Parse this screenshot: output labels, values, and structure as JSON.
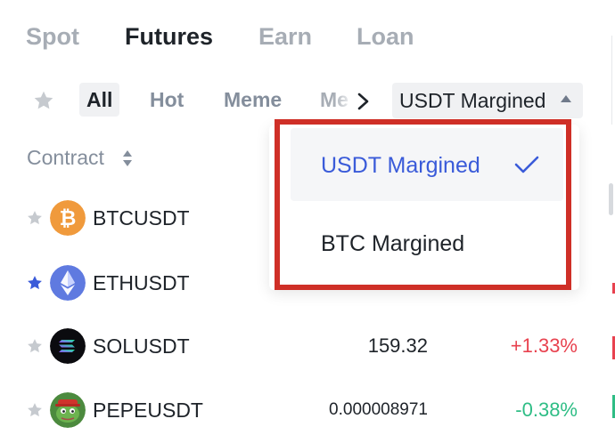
{
  "top_tabs": [
    "Spot",
    "Futures",
    "Earn",
    "Loan"
  ],
  "active_top_tab": "Futures",
  "filters": {
    "chips": [
      "All",
      "Hot",
      "Meme",
      "Me"
    ],
    "active": "All",
    "selector_label": "USDT Margined",
    "favorite_icon": "star-icon",
    "scroll_icon": "chevron-right-icon",
    "selector_icon": "caret-up-icon"
  },
  "table": {
    "header_label": "Contract",
    "sort_icon": "sort-icon",
    "rows": [
      {
        "symbol": "BTCUSDT",
        "favorite": false,
        "price": "",
        "change": "",
        "coin_icon": "bitcoin-icon"
      },
      {
        "symbol": "ETHUSDT",
        "favorite": true,
        "price": "",
        "change": "",
        "coin_icon": "ethereum-icon"
      },
      {
        "symbol": "SOLUSDT",
        "favorite": false,
        "price": "159.32",
        "change": "+1.33%",
        "coin_icon": "solana-icon"
      },
      {
        "symbol": "PEPEUSDT",
        "favorite": false,
        "price": "0.000008971",
        "change": "-0.38%",
        "coin_icon": "pepe-icon"
      }
    ]
  },
  "dropdown": {
    "items": [
      "USDT Margined",
      "BTC Margined"
    ],
    "selected": "USDT Margined",
    "check_icon": "check-icon"
  },
  "colors": {
    "accent": "#3a5bd9",
    "up": "#e8424f",
    "down": "#2ebd85",
    "highlight": "#cf2f27",
    "favorite_star": "#3a5bd9",
    "inactive_star": "#c6cacf"
  }
}
